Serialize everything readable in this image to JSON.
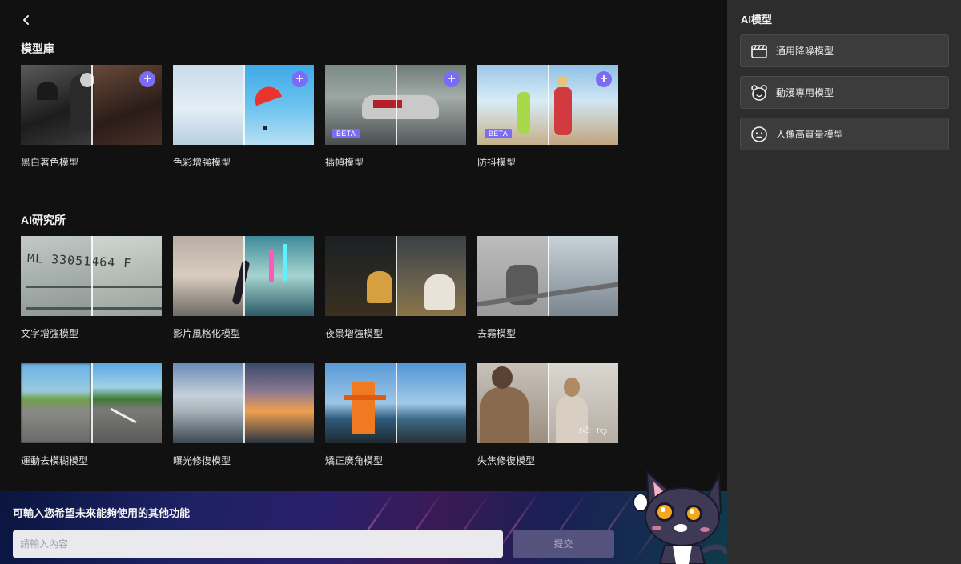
{
  "nav": {
    "back_icon": "chevron-left-icon"
  },
  "library": {
    "title": "模型庫",
    "cards": [
      {
        "label": "黑白著色模型",
        "add": true,
        "beta": false
      },
      {
        "label": "色彩增強模型",
        "add": true,
        "beta": false
      },
      {
        "label": "插幀模型",
        "add": true,
        "beta": true,
        "beta_label": "BETA"
      },
      {
        "label": "防抖模型",
        "add": true,
        "beta": true,
        "beta_label": "BETA"
      }
    ]
  },
  "lab": {
    "title": "AI研究所",
    "cards": [
      {
        "label": "文字增強模型"
      },
      {
        "label": "影片風格化模型"
      },
      {
        "label": "夜景增強模型"
      },
      {
        "label": "去霧模型"
      },
      {
        "label": "運動去模糊模型"
      },
      {
        "label": "曝光修復模型"
      },
      {
        "label": "矯正廣角模型"
      },
      {
        "label": "失焦修復模型",
        "feedback": true
      }
    ]
  },
  "feedback": {
    "title": "可輸入您希望未來能夠使用的其他功能",
    "placeholder": "請輸入內容",
    "submit_label": "提交"
  },
  "sidebar": {
    "title": "AI模型",
    "items": [
      {
        "label": "通用降噪模型",
        "icon": "film-clapper-icon"
      },
      {
        "label": "動漫專用模型",
        "icon": "bear-face-icon"
      },
      {
        "label": "人像高質量模型",
        "icon": "face-icon"
      }
    ]
  },
  "colors": {
    "accent": "#7b6cf6",
    "sidebar_bg": "#2d2d2d",
    "main_bg": "#111111"
  }
}
